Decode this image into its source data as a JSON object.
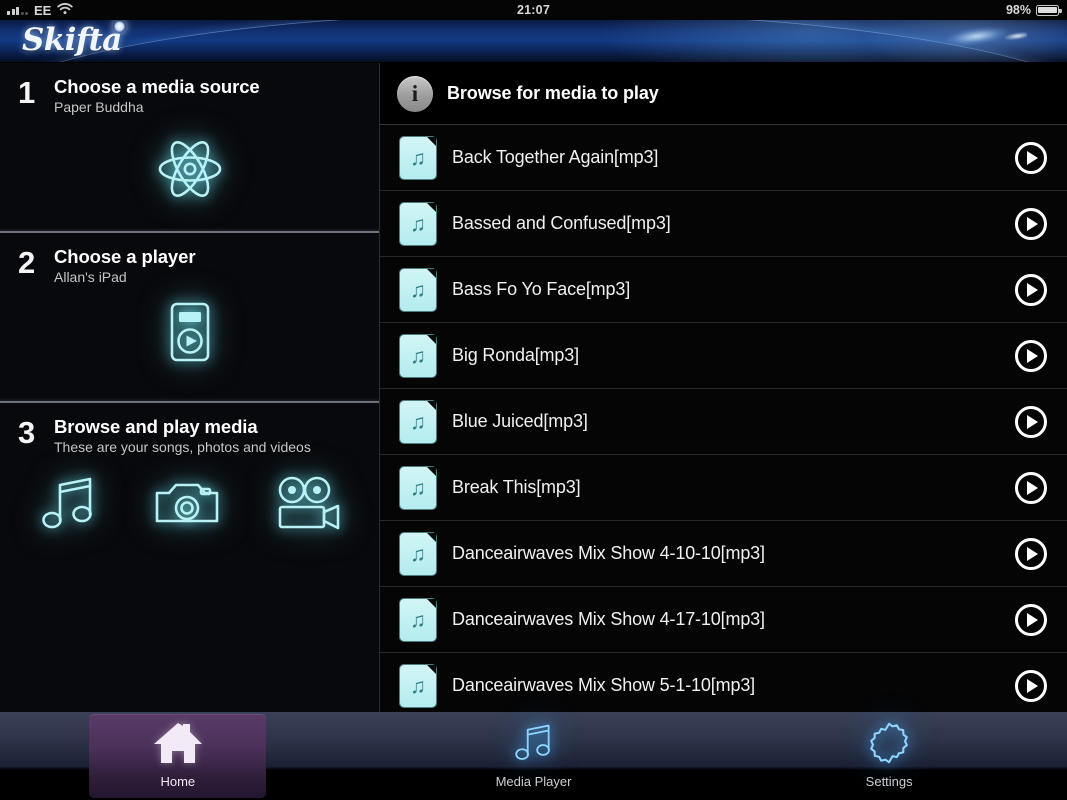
{
  "statusbar": {
    "carrier": "EE",
    "time": "21:07",
    "battery_percent": "98%",
    "signal_icon": "signal-bars-icon",
    "wifi_icon": "wifi-icon",
    "battery_icon": "battery-icon"
  },
  "header": {
    "app_name": "Skifta"
  },
  "sidebar": {
    "steps": [
      {
        "number": "1",
        "title": "Choose a media source",
        "subtitle": "Paper Buddha",
        "icon": "atom-icon"
      },
      {
        "number": "2",
        "title": "Choose a player",
        "subtitle": "Allan's iPad",
        "icon": "media-player-device-icon"
      },
      {
        "number": "3",
        "title": "Browse and play media",
        "subtitle": "These are your songs, photos and videos",
        "icons": [
          "music-note-icon",
          "camera-icon",
          "video-camera-icon"
        ]
      }
    ]
  },
  "main": {
    "header": {
      "icon": "info-icon",
      "title": "Browse for media to play"
    },
    "items": [
      {
        "title": "Back Together Again[mp3]",
        "icon": "music-file-icon",
        "action": "play-button"
      },
      {
        "title": "Bassed and Confused[mp3]",
        "icon": "music-file-icon",
        "action": "play-button"
      },
      {
        "title": "Bass Fo Yo Face[mp3]",
        "icon": "music-file-icon",
        "action": "play-button"
      },
      {
        "title": "Big Ronda[mp3]",
        "icon": "music-file-icon",
        "action": "play-button"
      },
      {
        "title": "Blue Juiced[mp3]",
        "icon": "music-file-icon",
        "action": "play-button"
      },
      {
        "title": "Break This[mp3]",
        "icon": "music-file-icon",
        "action": "play-button"
      },
      {
        "title": "Danceairwaves Mix Show 4-10-10[mp3]",
        "icon": "music-file-icon",
        "action": "play-button"
      },
      {
        "title": "Danceairwaves Mix Show 4-17-10[mp3]",
        "icon": "music-file-icon",
        "action": "play-button"
      },
      {
        "title": "Danceairwaves Mix Show 5-1-10[mp3]",
        "icon": "music-file-icon",
        "action": "play-button"
      }
    ]
  },
  "tabbar": {
    "tabs": [
      {
        "label": "Home",
        "icon": "home-icon",
        "active": true
      },
      {
        "label": "Media Player",
        "icon": "music-note-icon",
        "active": false
      },
      {
        "label": "Settings",
        "icon": "gear-icon",
        "active": false
      }
    ]
  },
  "colors": {
    "accent_cyan": "#b9f2f6",
    "accent_blue": "#8fd4ff",
    "active_tab_purple": "#4a3059",
    "header_blue": "#123a84",
    "background": "#000000"
  }
}
